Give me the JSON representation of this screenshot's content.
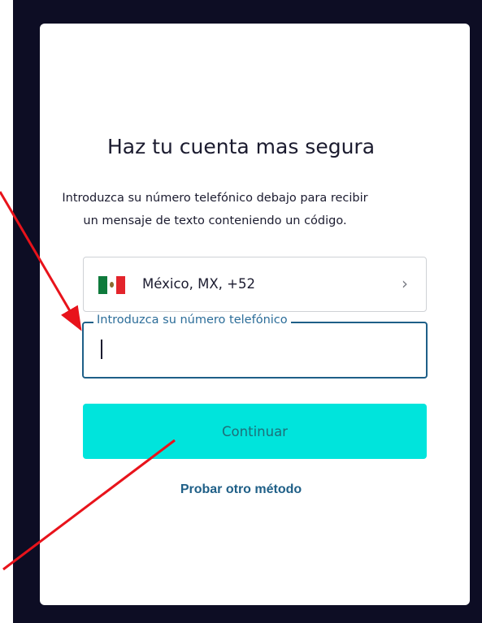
{
  "page": {
    "title": "Haz tu cuenta mas segura",
    "subtitle_line1": "Introduzca su número telefónico debajo para recibir",
    "subtitle_line2": "un mensaje de texto conteniendo un código."
  },
  "country_select": {
    "label": "México, MX, +52",
    "flag_icon": "mexico-flag-icon",
    "chevron_icon": "chevron-right-icon"
  },
  "phone_field": {
    "legend": "Introduzca su número telefónico",
    "value": ""
  },
  "continue_button": {
    "label": "Continuar"
  },
  "alt_method_link": {
    "label": "Probar otro método"
  },
  "colors": {
    "backdrop": "#0d0d24",
    "accent_button": "#00e4dc",
    "focus_border": "#1e5f88",
    "annotation_arrow": "#e8131b"
  }
}
